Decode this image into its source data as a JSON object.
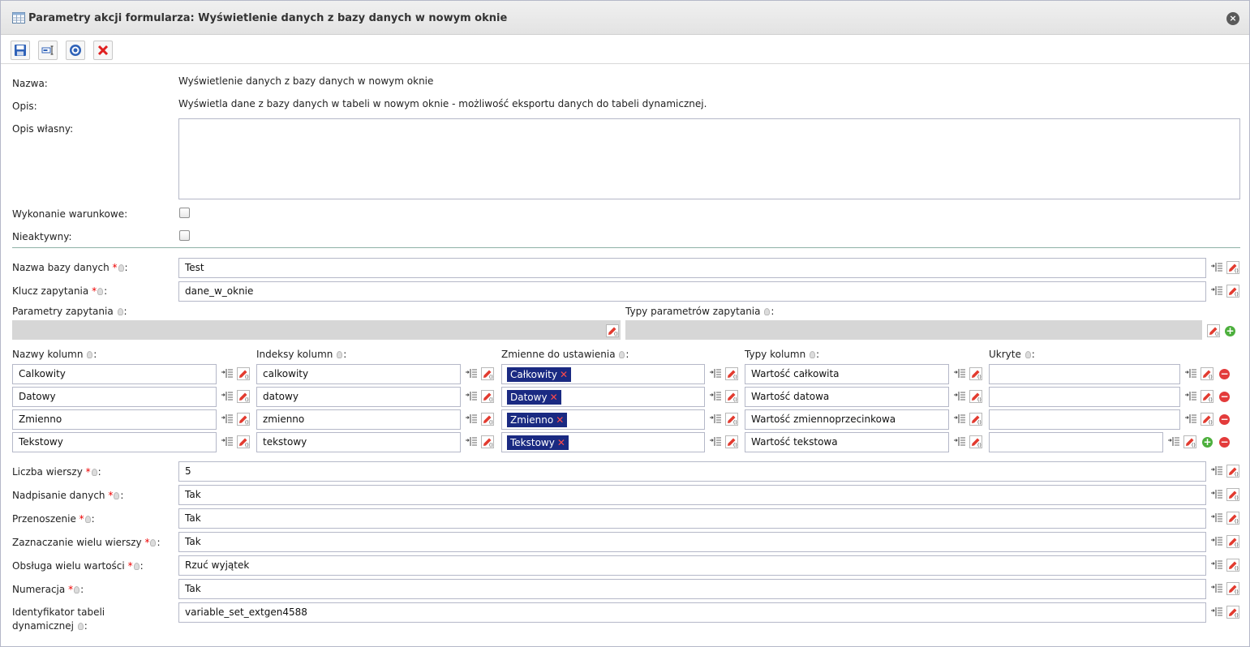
{
  "window": {
    "title": "Parametry akcji formularza: Wyświetlenie danych z bazy danych w nowym oknie"
  },
  "toolbar": [
    "save-icon",
    "rename-icon",
    "help-icon",
    "delete-icon"
  ],
  "general": {
    "name_label": "Nazwa:",
    "name_value": "Wyświetlenie danych z bazy danych w nowym oknie",
    "desc_label": "Opis:",
    "desc_value": "Wyświetla dane z bazy danych w tabeli w nowym oknie - możliwość eksportu danych do tabeli dynamicznej.",
    "own_desc_label": "Opis własny:",
    "own_desc_value": "",
    "conditional_label": "Wykonanie warunkowe:",
    "conditional_checked": false,
    "inactive_label": "Nieaktywny:",
    "inactive_checked": false
  },
  "db": {
    "db_name_label": "Nazwa bazy danych",
    "db_name_value": "Test",
    "query_key_label": "Klucz zapytania",
    "query_key_value": "dane_w_oknie"
  },
  "query_params": {
    "params_label": "Parametry zapytania",
    "types_label": "Typy parametrów zapytania"
  },
  "columns": {
    "headers": {
      "names": "Nazwy kolumn",
      "indexes": "Indeksy kolumn",
      "variables": "Zmienne do ustawienia",
      "types": "Typy kolumn",
      "hidden": "Ukryte"
    },
    "rows": [
      {
        "name": "Calkowity",
        "index": "calkowity",
        "variable": "Całkowity",
        "type": "Wartość całkowita",
        "hidden": ""
      },
      {
        "name": "Datowy",
        "index": "datowy",
        "variable": "Datowy",
        "type": "Wartość datowa",
        "hidden": ""
      },
      {
        "name": "Zmienno",
        "index": "zmienno",
        "variable": "Zmienno",
        "type": "Wartość zmiennoprzecinkowa",
        "hidden": ""
      },
      {
        "name": "Tekstowy",
        "index": "tekstowy",
        "variable": "Tekstowy",
        "type": "Wartość tekstowa",
        "hidden": ""
      }
    ]
  },
  "settings": {
    "rows_count_label": "Liczba wierszy",
    "rows_count_value": "5",
    "overwrite_label": "Nadpisanie danych",
    "overwrite_value": "Tak",
    "wrap_label": "Przenoszenie",
    "wrap_value": "Tak",
    "multiselect_label": "Zaznaczanie wielu wierszy",
    "multiselect_value": "Tak",
    "multivalue_label": "Obsługa wielu wartości",
    "multivalue_value": "Rzuć wyjątek",
    "numbering_label": "Numeracja",
    "numbering_value": "Tak",
    "table_id_label_1": "Identyfikator tabeli",
    "table_id_label_2": "dynamicznej",
    "table_id_value": "variable_set_extgen4588"
  }
}
